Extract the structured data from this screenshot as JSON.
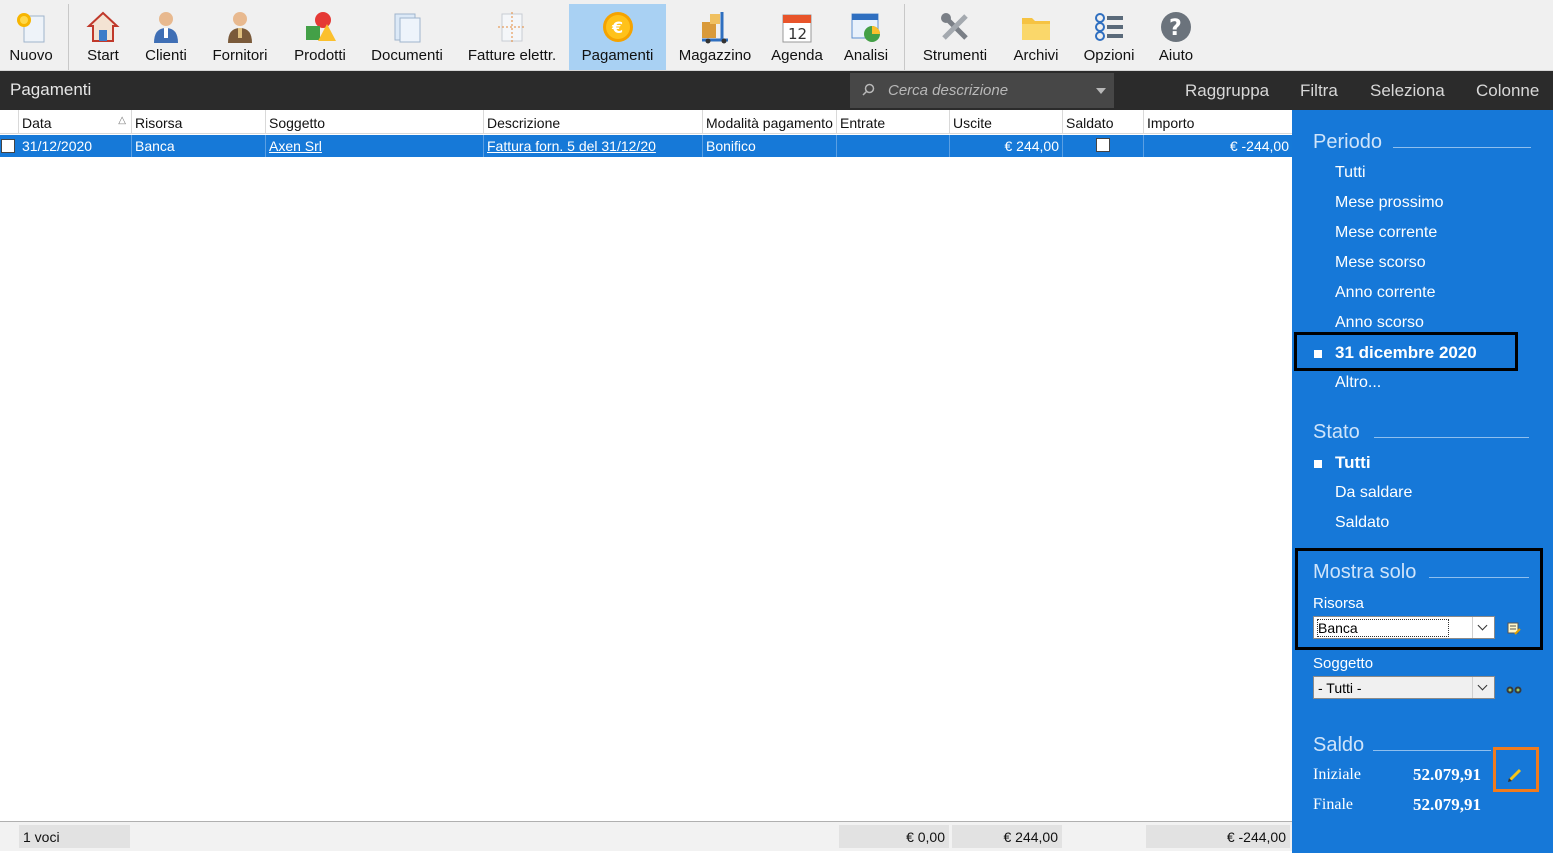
{
  "toolbar": {
    "items": [
      {
        "label": "Nuovo",
        "icon": "new-document-sun-icon"
      },
      {
        "label": "Start",
        "icon": "home-icon"
      },
      {
        "label": "Clienti",
        "icon": "customer-person-icon"
      },
      {
        "label": "Fornitori",
        "icon": "supplier-person-icon"
      },
      {
        "label": "Prodotti",
        "icon": "products-shapes-icon"
      },
      {
        "label": "Documenti",
        "icon": "documents-icon"
      },
      {
        "label": "Fatture elettr.",
        "icon": "e-invoice-icon"
      },
      {
        "label": "Pagamenti",
        "icon": "euro-coin-icon"
      },
      {
        "label": "Magazzino",
        "icon": "warehouse-trolley-icon"
      },
      {
        "label": "Agenda",
        "icon": "calendar-icon"
      },
      {
        "label": "Analisi",
        "icon": "analysis-chart-icon"
      },
      {
        "label": "Strumenti",
        "icon": "tools-icon"
      },
      {
        "label": "Archivi",
        "icon": "archive-folder-icon"
      },
      {
        "label": "Opzioni",
        "icon": "options-list-icon"
      },
      {
        "label": "Aiuto",
        "icon": "help-icon"
      }
    ],
    "active": "Pagamenti"
  },
  "titlebar": {
    "title": "Pagamenti",
    "search_placeholder": "Cerca descrizione",
    "actions": [
      "Raggruppa",
      "Filtra",
      "Seleziona",
      "Colonne"
    ]
  },
  "table": {
    "columns": [
      "Data",
      "Risorsa",
      "Soggetto",
      "Descrizione",
      "Modalità pagamento",
      "Entrate",
      "Uscite",
      "Saldato",
      "Importo"
    ],
    "rows": [
      {
        "data": "31/12/2020",
        "risorsa": "Banca",
        "soggetto": "Axen Srl",
        "descrizione": "Fattura forn. 5 del 31/12/20",
        "modalita": "Bonifico",
        "entrate": "",
        "uscite": "€ 244,00",
        "saldato": false,
        "importo": "€ -244,00"
      }
    ]
  },
  "footer": {
    "count": "1 voci",
    "entrate": "€ 0,00",
    "uscite": "€ 244,00",
    "importo": "€ -244,00"
  },
  "sidebar": {
    "periodo": {
      "title": "Periodo",
      "options": [
        "Tutti",
        "Mese prossimo",
        "Mese corrente",
        "Mese scorso",
        "Anno corrente",
        "Anno scorso",
        "31 dicembre 2020",
        "Altro..."
      ],
      "selected": "31 dicembre 2020"
    },
    "stato": {
      "title": "Stato",
      "options": [
        "Tutti",
        "Da saldare",
        "Saldato"
      ],
      "selected": "Tutti"
    },
    "mostra_solo": {
      "title": "Mostra solo",
      "risorsa_label": "Risorsa",
      "risorsa_value": "Banca",
      "soggetto_label": "Soggetto",
      "soggetto_value": " - Tutti -"
    },
    "saldo": {
      "title": "Saldo",
      "iniziale_label": "Iniziale",
      "iniziale_value": "52.079,91",
      "finale_label": "Finale",
      "finale_value": "52.079,91"
    }
  },
  "colors": {
    "sidebar_bg": "#1678d8",
    "selected_row": "#1679d8",
    "active_tab": "#a9d1f3",
    "highlight_orange": "#f07b1d"
  }
}
